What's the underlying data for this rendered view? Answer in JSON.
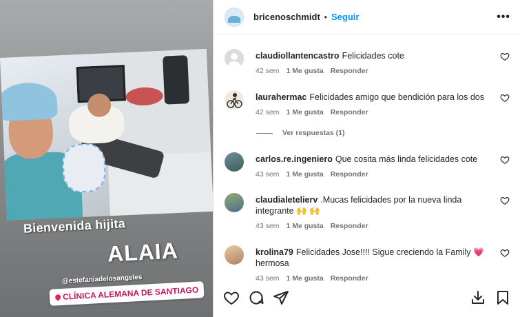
{
  "story": {
    "caption_line1": "Bienvenida hijita",
    "caption_line2": "ALAIA",
    "mention": "@estefaniadelosangeles",
    "location": "CLÍNICA ALEMANA DE SANTIAGO"
  },
  "header": {
    "username": "bricenoschmidt",
    "separator": "•",
    "follow_label": "Seguir",
    "more_label": "•••"
  },
  "comments": [
    {
      "user": "claudiollantencastro",
      "text": "Felicidades cote",
      "age": "42 sem",
      "likes": "1 Me gusta",
      "reply": "Responder"
    },
    {
      "user": "laurahermac",
      "text": "Felicidades amigo que bendición para los dos",
      "age": "42 sem",
      "likes": "1 Me gusta",
      "reply": "Responder"
    },
    {
      "user": "carlos.re.ingeniero",
      "text": "Que cosita más linda felicidades cote",
      "age": "43 sem",
      "likes": "1 Me gusta",
      "reply": "Responder"
    },
    {
      "user": "claudialetelierv",
      "text": ".Mucas felicidades por la nueva linda integrante 🙌 🙌",
      "age": "43 sem",
      "likes": "1 Me gusta",
      "reply": "Responder"
    },
    {
      "user": "krolina79",
      "text": "Felicidades Jose!!!! Sigue creciendo la Family 💗 hermosa",
      "age": "43 sem",
      "likes": "1 Me gusta",
      "reply": "Responder"
    }
  ],
  "view_replies": "Ver respuestas (1)",
  "icons": {
    "like": "heart-icon",
    "comment": "comment-icon",
    "share": "share-icon",
    "download": "download-icon",
    "save": "bookmark-icon"
  },
  "colors": {
    "accent": "#0095f6",
    "text": "#262626",
    "muted": "#737373",
    "location": "#c2185b"
  }
}
